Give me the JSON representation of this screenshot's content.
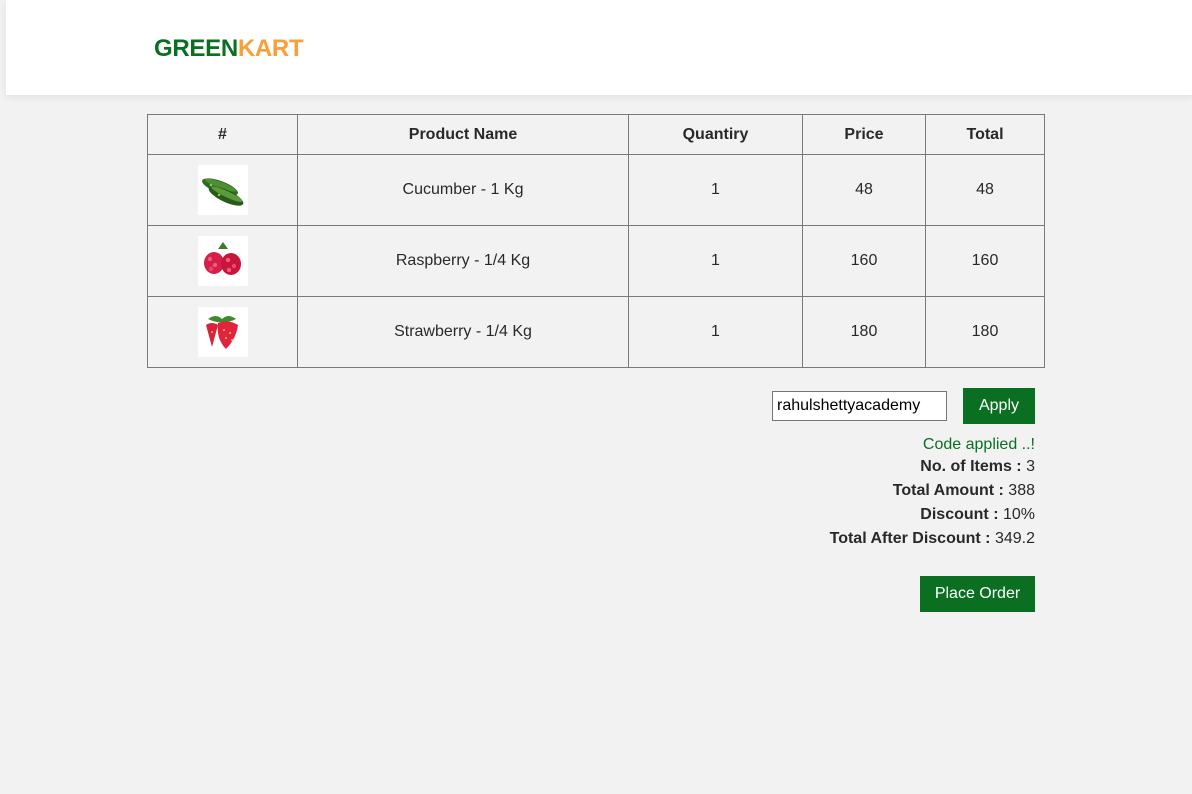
{
  "brand": {
    "part1": "GREEN",
    "part2": "KART"
  },
  "table": {
    "headers": [
      "#",
      "Product Name",
      "Quantiry",
      "Price",
      "Total"
    ],
    "rows": [
      {
        "name": "Cucumber - 1 Kg",
        "qty": "1",
        "price": "48",
        "total": "48",
        "image": "cucumber-image"
      },
      {
        "name": "Raspberry - 1/4 Kg",
        "qty": "1",
        "price": "160",
        "total": "160",
        "image": "raspberry-image"
      },
      {
        "name": "Strawberry - 1/4 Kg",
        "qty": "1",
        "price": "180",
        "total": "180",
        "image": "strawberry-image"
      }
    ]
  },
  "promo": {
    "code_value": "rahulshettyacademy",
    "apply_label": "Apply",
    "info": "Code applied ..!"
  },
  "summary": {
    "items_label": "No. of Items :",
    "items_value": "3",
    "amount_label": "Total Amount :",
    "amount_value": "388",
    "discount_label": "Discount :",
    "discount_value": "10%",
    "after_label": "Total After Discount :",
    "after_value": "349.2"
  },
  "place_order_label": "Place Order",
  "colors": {
    "brand_green": "#0b6f22",
    "brand_orange": "#f8a037",
    "background": "#f2f2f2"
  }
}
